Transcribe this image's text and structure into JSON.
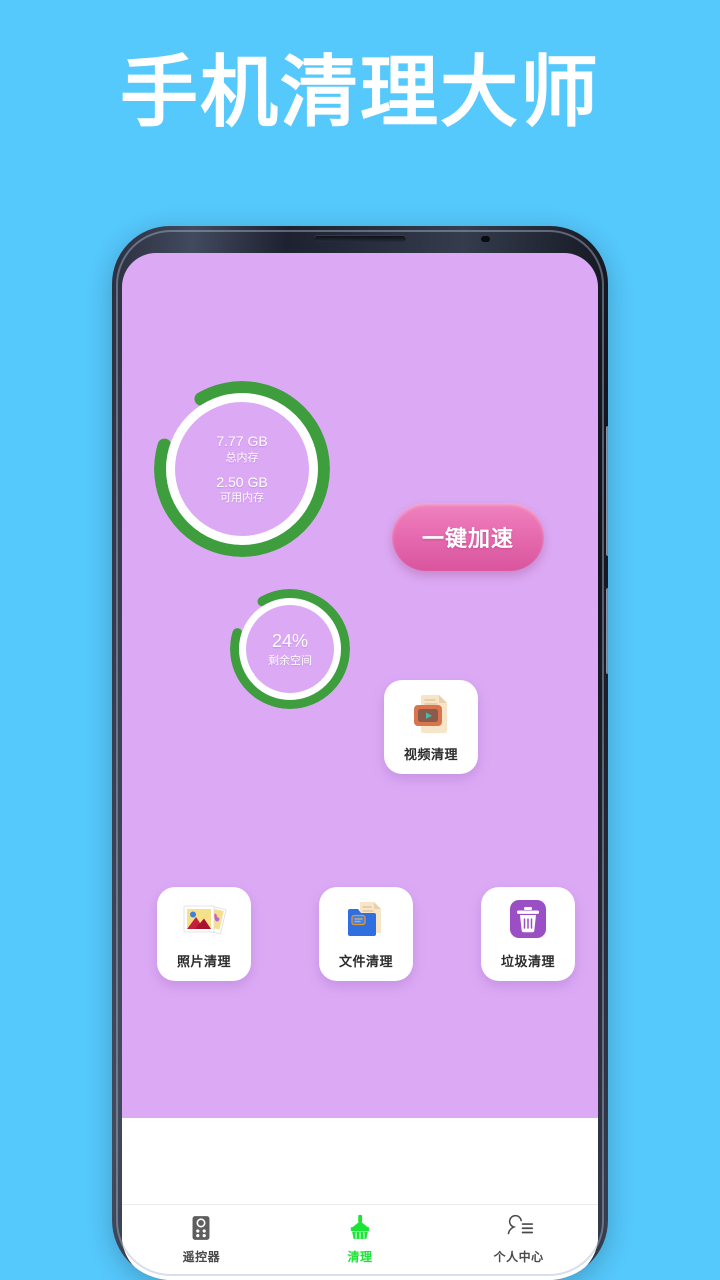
{
  "headline": "手机清理大师",
  "colors": {
    "page_background": "#55c8fc",
    "screen_background": "#dcaaf5",
    "ring_progress": "#3e9e3e",
    "ring_track": "#ffffff",
    "accelerate_button": "#e76bb0",
    "active_nav": "#1ce436",
    "card_background": "#ffffff"
  },
  "memory_ring": {
    "total_value": "7.77 GB",
    "total_label": "总内存",
    "available_value": "2.50 GB",
    "available_label": "可用内存",
    "progress_percent": 88
  },
  "storage_ring": {
    "value": "24%",
    "label": "剩余空间",
    "progress_percent": 88
  },
  "accelerate_button": {
    "label": "一键加速"
  },
  "cards": [
    {
      "id": "video",
      "label": "视频清理",
      "icon": "video-file-icon"
    },
    {
      "id": "photo",
      "label": "照片清理",
      "icon": "photo-stack-icon"
    },
    {
      "id": "file",
      "label": "文件清理",
      "icon": "folder-icon"
    },
    {
      "id": "trash",
      "label": "垃圾清理",
      "icon": "trash-can-icon"
    }
  ],
  "navbar": {
    "items": [
      {
        "id": "remote",
        "label": "遥控器",
        "icon": "remote-control-icon",
        "active": false
      },
      {
        "id": "clean",
        "label": "清理",
        "icon": "broom-icon",
        "active": true
      },
      {
        "id": "profile",
        "label": "个人中心",
        "icon": "person-menu-icon",
        "active": false
      }
    ]
  }
}
